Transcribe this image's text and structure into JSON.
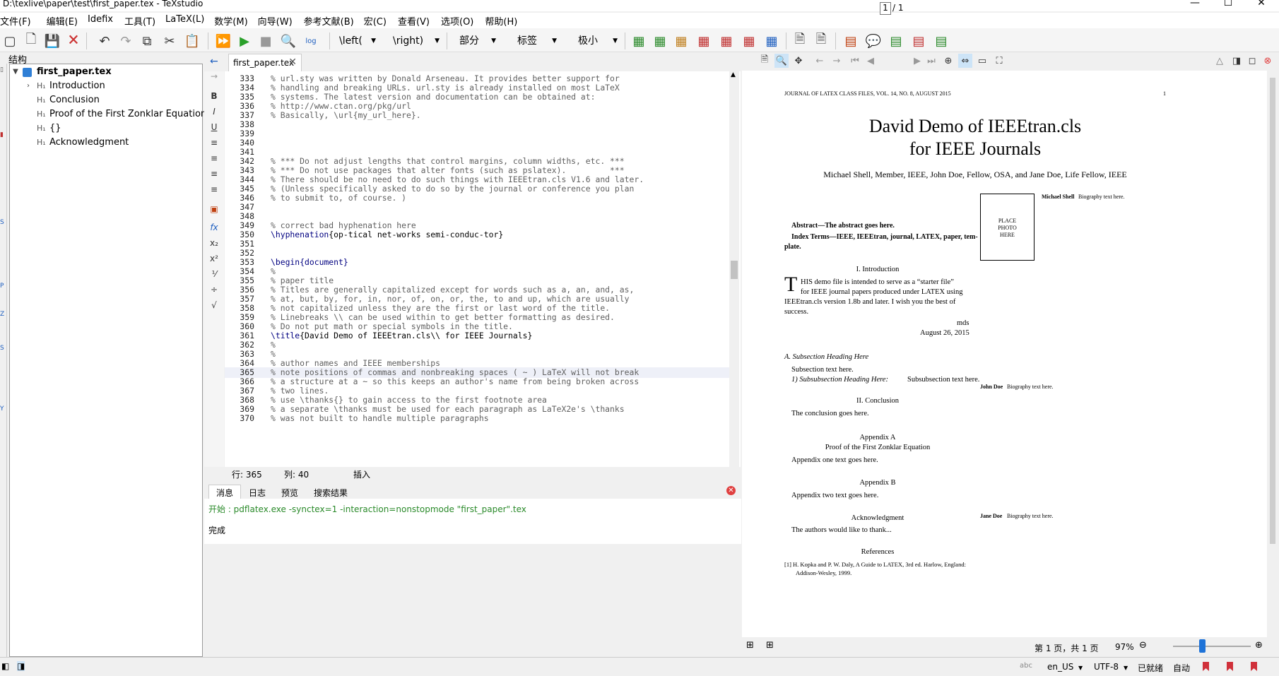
{
  "window": {
    "title": "D:\\texlive\\paper\\test\\first_paper.tex - TeXstudio",
    "minimize": "—",
    "maximize": "☐",
    "close": "✕"
  },
  "menu": [
    "文件(F)",
    "编辑(E)",
    "Idefix",
    "工具(T)",
    "LaTeX(L)",
    "数学(M)",
    "向导(W)",
    "参考文献(B)",
    "宏(C)",
    "查看(V)",
    "选项(O)",
    "帮助(H)"
  ],
  "toolbar": {
    "combos": [
      "\\left(",
      "\\right)",
      "部分",
      "标签",
      "极小"
    ],
    "log_label": "log"
  },
  "structure": {
    "header": "结构",
    "items": [
      {
        "label": "first_paper.tex",
        "icon": "tex-file-icon",
        "bold": true
      },
      {
        "label": "Introduction",
        "icon": "H1"
      },
      {
        "label": "Conclusion",
        "icon": "H1"
      },
      {
        "label": "Proof of the First Zonklar Equation",
        "icon": "H1"
      },
      {
        "label": "{}",
        "icon": "H1"
      },
      {
        "label": "Acknowledgment",
        "icon": "H1"
      }
    ]
  },
  "editor": {
    "tab": "first_paper.tex",
    "lines": [
      {
        "n": "333",
        "text": "% url.sty was written by Donald Arseneau. It provides better support for",
        "type": "com"
      },
      {
        "n": "334",
        "text": "% handling and breaking URLs. url.sty is already installed on most LaTeX",
        "type": "com"
      },
      {
        "n": "335",
        "text": "% systems. The latest version and documentation can be obtained at:",
        "type": "com"
      },
      {
        "n": "336",
        "text": "% http://www.ctan.org/pkg/url",
        "type": "com"
      },
      {
        "n": "337",
        "text": "% Basically, \\url{my_url_here}.",
        "type": "com"
      },
      {
        "n": "338",
        "text": "",
        "type": "com"
      },
      {
        "n": "339",
        "text": "",
        "type": "com"
      },
      {
        "n": "340",
        "text": "",
        "type": "com"
      },
      {
        "n": "341",
        "text": "",
        "type": "com"
      },
      {
        "n": "342",
        "text": "% *** Do not adjust lengths that control margins, column widths, etc. ***",
        "type": "com"
      },
      {
        "n": "343",
        "text": "% *** Do not use packages that alter fonts (such as pslatex).         ***",
        "type": "com"
      },
      {
        "n": "344",
        "text": "% There should be no need to do such things with IEEEtran.cls V1.6 and later.",
        "type": "com"
      },
      {
        "n": "345",
        "text": "% (Unless specifically asked to do so by the journal or conference you plan",
        "type": "com"
      },
      {
        "n": "346",
        "text": "% to submit to, of course. )",
        "type": "com"
      },
      {
        "n": "347",
        "text": "",
        "type": "com"
      },
      {
        "n": "348",
        "text": "",
        "type": "com"
      },
      {
        "n": "349",
        "text": "% correct bad hyphenation here",
        "type": "com"
      },
      {
        "n": "350",
        "text": "",
        "cmd": "\\hyphenation",
        "arg": "{op-tical net-works semi-conduc-tor}",
        "type": "cmd"
      },
      {
        "n": "351",
        "text": "",
        "type": "com"
      },
      {
        "n": "352",
        "text": "",
        "type": "com"
      },
      {
        "n": "353",
        "text": "",
        "cmd": "\\begin",
        "arg": "{document}",
        "type": "kw"
      },
      {
        "n": "354",
        "text": "%",
        "type": "com"
      },
      {
        "n": "355",
        "text": "% paper title",
        "type": "com"
      },
      {
        "n": "356",
        "text": "% Titles are generally capitalized except for words such as a, an, and, as,",
        "type": "com"
      },
      {
        "n": "357",
        "text": "% at, but, by, for, in, nor, of, on, or, the, to and up, which are usually",
        "type": "com"
      },
      {
        "n": "358",
        "text": "% not capitalized unless they are the first or last word of the title.",
        "type": "com"
      },
      {
        "n": "359",
        "text": "% Linebreaks \\\\ can be used within to get better formatting as desired.",
        "type": "com"
      },
      {
        "n": "360",
        "text": "% Do not put math or special symbols in the title.",
        "type": "com"
      },
      {
        "n": "361",
        "text": "",
        "cmd": "\\title",
        "arg": "{David Demo of IEEEtran.cls\\\\ for IEEE Journals}",
        "type": "cmd"
      },
      {
        "n": "362",
        "text": "%",
        "type": "com"
      },
      {
        "n": "363",
        "text": "%",
        "type": "com"
      },
      {
        "n": "364",
        "text": "% author names and IEEE memberships",
        "type": "com"
      },
      {
        "n": "365",
        "text": "% note positions of commas and nonbreaking spaces ( ~ ) LaTeX will not break",
        "type": "com",
        "current": true
      },
      {
        "n": "366",
        "text": "% a structure at a ~ so this keeps an author's name from being broken across",
        "type": "com"
      },
      {
        "n": "367",
        "text": "% two lines.",
        "type": "com"
      },
      {
        "n": "368",
        "text": "% use \\thanks{} to gain access to the first footnote area",
        "type": "com"
      },
      {
        "n": "369",
        "text": "% a separate \\thanks must be used for each paragraph as LaTeX2e's \\thanks",
        "type": "com"
      },
      {
        "n": "370",
        "text": "% was not built to handle multiple paragraphs",
        "type": "com"
      }
    ],
    "status": {
      "row_label": "行: 365",
      "col_label": "列: 40",
      "mode": "插入"
    }
  },
  "messages": {
    "tabs": [
      "消息",
      "日志",
      "预览",
      "搜索结果"
    ],
    "lines": [
      {
        "text": "开始 : pdflatex.exe -synctex=1 -interaction=nonstopmode \"first_paper\".tex",
        "color": "#2a8a2a"
      },
      {
        "text": "完成",
        "color": "#000000"
      }
    ]
  },
  "pdf": {
    "page_input": "1",
    "page_total": "/ 1",
    "header_left": "JOURNAL OF LATEX CLASS FILES, VOL. 14, NO. 8, AUGUST 2015",
    "header_page": "1",
    "title1": "David Demo of IEEEtran.cls",
    "title2": "for IEEE Journals",
    "authors": "Michael Shell, Member, IEEE, John Doe, Fellow, OSA, and Jane Doe, Life Fellow, IEEE",
    "abstract": "Abstract—The abstract goes here.",
    "index_terms": "Index Terms—IEEE, IEEEtran, journal, LATEX, paper, tem-",
    "index_terms2": "plate.",
    "sec1": "I. Introduction",
    "intro_lines": [
      "HIS demo file is intended to serve as a “starter file”",
      "for IEEE journal papers produced under LATEX using",
      "IEEEtran.cls version 1.8b and later. I wish you the best of",
      "success."
    ],
    "dropcap": "T",
    "mds": "mds",
    "date": "August 26, 2015",
    "subsec": "A.  Subsection Heading Here",
    "subsec_text": "Subsection text here.",
    "subsubsec": "1)  Subsubsection Heading Here:",
    "subsubsec_text": "Subsubsection text here.",
    "sec2": "II. Conclusion",
    "conclusion": "The conclusion goes here.",
    "appA": "Appendix A",
    "appA_title": "Proof of the First Zonklar Equation",
    "appA_text": "Appendix one text goes here.",
    "appB": "Appendix B",
    "appB_text": "Appendix two text goes here.",
    "ack": "Acknowledgment",
    "ack_text": "The authors would like to thank...",
    "refs": "References",
    "ref1a": "[1]  H. Kopka and P. W. Daly, A Guide to LATEX, 3rd ed.   Harlow, England:",
    "ref1b": "Addison-Wesley, 1999.",
    "photo": [
      "PLACE",
      "PHOTO",
      "HERE"
    ],
    "bio1_name": "Michael Shell",
    "bio1_text": "Biography text here.",
    "bio2_name": "John Doe",
    "bio2_text": "Biography text here.",
    "bio3_name": "Jane Doe",
    "bio3_text": "Biography text here.",
    "status_page": "第 1 页，共 1 页",
    "zoom": "97%"
  },
  "statusbar": {
    "lang": "en_US",
    "encoding": "UTF-8",
    "state": "已就绪",
    "auto": "自动"
  }
}
